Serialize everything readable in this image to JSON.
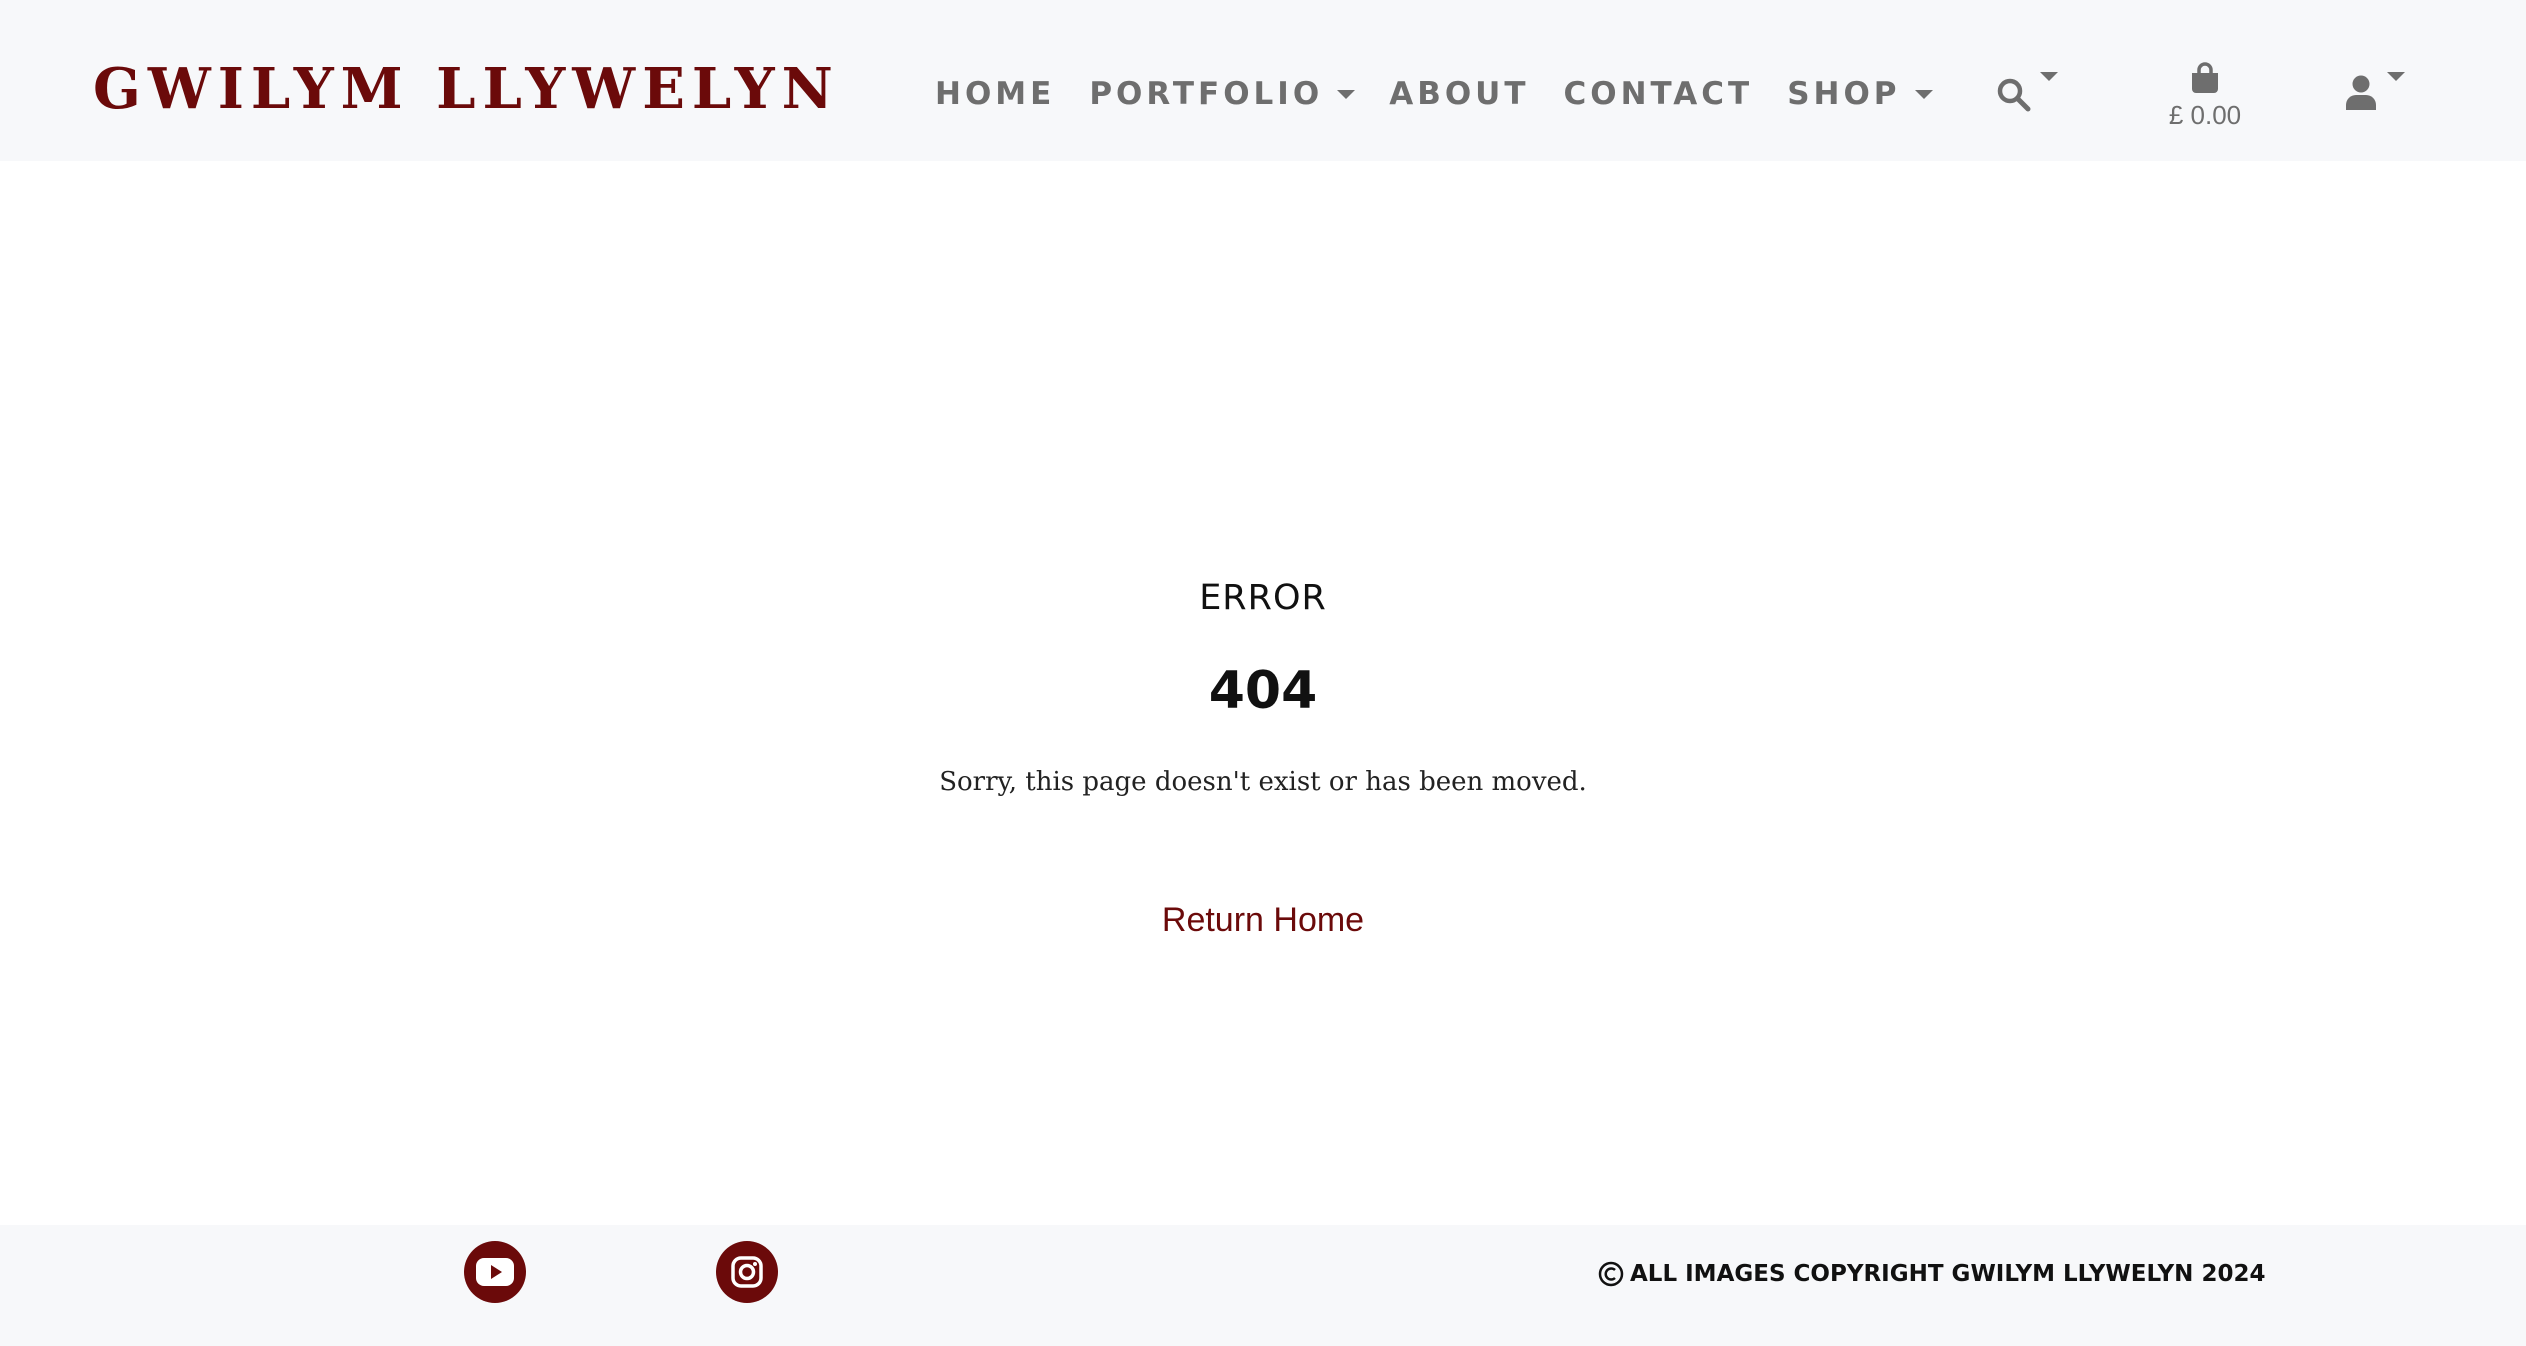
{
  "header": {
    "brand": "GWILYM LLYWELYN",
    "nav": [
      {
        "label": "HOME",
        "has_dropdown": false
      },
      {
        "label": "PORTFOLIO",
        "has_dropdown": true
      },
      {
        "label": "ABOUT",
        "has_dropdown": false
      },
      {
        "label": "CONTACT",
        "has_dropdown": false
      },
      {
        "label": "SHOP",
        "has_dropdown": true
      }
    ],
    "cart_total": "£ 0.00",
    "icons": {
      "search": "search-icon",
      "cart": "shopping-bag-icon",
      "account": "user-icon"
    }
  },
  "main": {
    "error_label": "ERROR",
    "error_code": "404",
    "message": "Sorry, this page doesn't exist or has been moved.",
    "return_link": "Return Home"
  },
  "footer": {
    "social": [
      {
        "icon": "youtube-icon"
      },
      {
        "icon": "instagram-icon"
      }
    ],
    "copyright": "ALL IMAGES COPYRIGHT GWILYM LLYWELYN 2024"
  },
  "colors": {
    "brand": "#6b0a0a",
    "nav_text": "#6e6e6e",
    "header_bg": "#f7f8fa",
    "footer_bg": "#f7f8fa",
    "body_bg": "#ffffff"
  }
}
